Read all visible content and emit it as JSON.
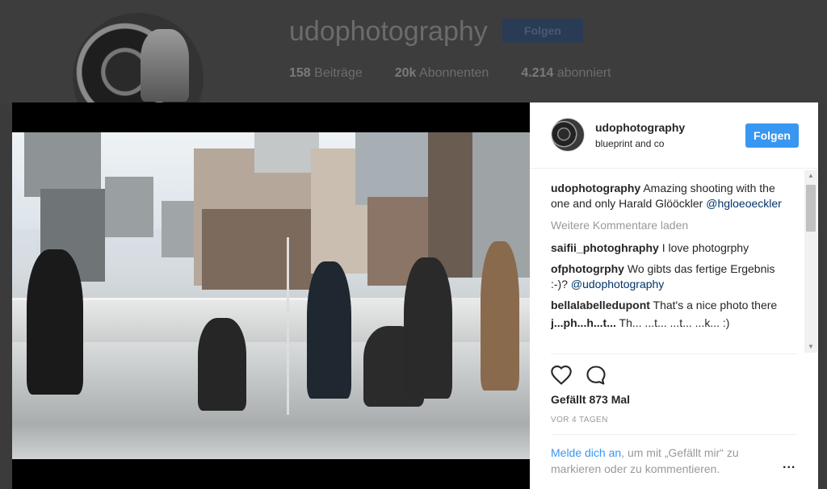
{
  "profile": {
    "username": "udophotography",
    "follow_label": "Folgen",
    "stats": [
      {
        "count": "158",
        "label": "Beiträge"
      },
      {
        "count": "20k",
        "label": "Abonnenten"
      },
      {
        "count": "4.214",
        "label": "abonniert"
      }
    ]
  },
  "post": {
    "username": "udophotography",
    "location": "blueprint and co",
    "follow_label": "Folgen",
    "caption": {
      "username": "udophotography",
      "text": "Amazing shooting with the one and only Harald Glööckler",
      "mention": "@hgloeoeckler"
    },
    "load_more": "Weitere Kommentare laden",
    "comments": [
      {
        "username": "saifii_photoghraphy",
        "text": "I love photogrphy",
        "mention": ""
      },
      {
        "username": "ofphotogrphy",
        "text": "Wo gibts das fertige Ergebnis :-)?",
        "mention": "@udophotography"
      },
      {
        "username": "bellalabelledupont",
        "text": "That's a nice photo there",
        "mention": ""
      },
      {
        "username": "j...ph...h...t...",
        "text": "Th... ...t... ...t...  ...k... :)",
        "mention": ""
      }
    ],
    "likes": "Gefällt 873 Mal",
    "time": "VOR 4 TAGEN",
    "login_link": "Melde dich an",
    "login_text": ", um mit „Gefällt mir“ zu markieren oder zu kommentieren.",
    "more_options": "..."
  },
  "icons": {
    "heart": "heart-icon",
    "comment": "comment-icon",
    "user_tag": "user-tag-icon",
    "more": "more-options-icon"
  },
  "colors": {
    "accent": "#3897f0",
    "link": "#003569",
    "muted": "#999999"
  }
}
